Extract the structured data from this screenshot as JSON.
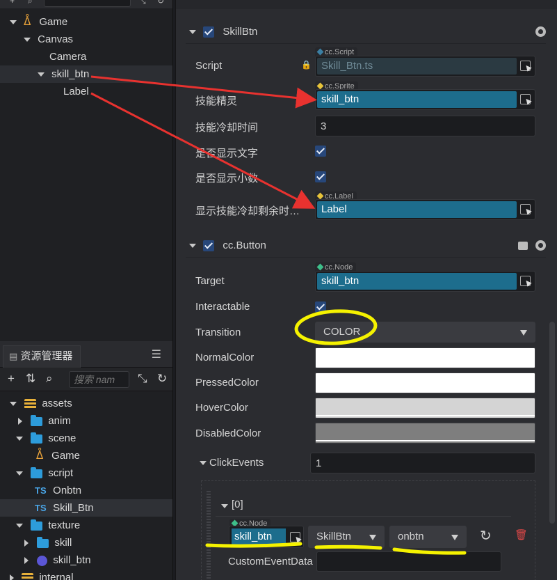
{
  "hierarchy": {
    "items": [
      {
        "label": "Game",
        "icon": "fire-icon"
      },
      {
        "label": "Canvas"
      },
      {
        "label": "Camera"
      },
      {
        "label": "skill_btn"
      },
      {
        "label": "Label"
      }
    ]
  },
  "assets": {
    "title": "资源管理器",
    "search_placeholder": "搜索 nam",
    "items": [
      {
        "label": "assets"
      },
      {
        "label": "anim"
      },
      {
        "label": "scene"
      },
      {
        "label": "Game"
      },
      {
        "label": "script"
      },
      {
        "label": "Onbtn",
        "badge": "TS"
      },
      {
        "label": "Skill_Btn",
        "badge": "TS"
      },
      {
        "label": "texture"
      },
      {
        "label": "skill"
      },
      {
        "label": "skill_btn"
      },
      {
        "label": "internal"
      }
    ]
  },
  "inspector": {
    "skillbtn": {
      "title": "SkillBtn",
      "script_label": "Script",
      "script_type": "cc.Script",
      "script_value": "Skill_Btn.ts",
      "sprite_label": "技能精灵",
      "sprite_type": "cc.Sprite",
      "sprite_value": "skill_btn",
      "cooldown_label": "技能冷却时间",
      "cooldown_value": "3",
      "showtext_label": "是否显示文字",
      "showdecimal_label": "是否显示小数",
      "remain_label": "显示技能冷却剩余时…",
      "remain_type": "cc.Label",
      "remain_value": "Label"
    },
    "button": {
      "title": "cc.Button",
      "target_label": "Target",
      "target_type": "cc.Node",
      "target_value": "skill_btn",
      "interactable_label": "Interactable",
      "transition_label": "Transition",
      "transition_value": "COLOR",
      "normal_label": "NormalColor",
      "pressed_label": "PressedColor",
      "hover_label": "HoverColor",
      "disabled_label": "DisabledColor",
      "click_label": "ClickEvents",
      "click_count": "1",
      "event_index": "[0]",
      "event_node_type": "cc.Node",
      "event_node_value": "skill_btn",
      "event_component": "SkillBtn",
      "event_handler": "onbtn",
      "custom_label": "CustomEventData"
    },
    "colors": {
      "normal": "#ffffff",
      "pressed": "#ffffff",
      "hover": "#d4d4d4",
      "disabled": "#7e7e7e",
      "ref_fill": "#1d6d8d",
      "checkbox": "#27477a",
      "arrow_red": "#e8322f",
      "highlight_yellow": "#f5f200"
    }
  }
}
